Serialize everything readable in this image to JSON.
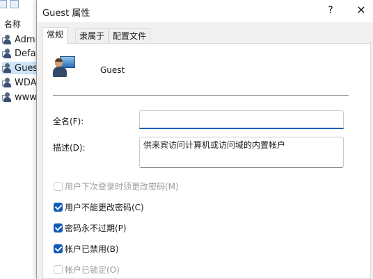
{
  "background_window": {
    "column_header": "名称",
    "rows": [
      {
        "label": "Admi",
        "selected": false
      },
      {
        "label": "Defau",
        "selected": false
      },
      {
        "label": "Guest",
        "selected": true
      },
      {
        "label": "WDA",
        "selected": false
      },
      {
        "label": "www.",
        "selected": false
      }
    ]
  },
  "dialog": {
    "title": "Guest 属性",
    "help_label": "?",
    "close_label": "✕",
    "tabs": [
      {
        "label": "常规",
        "active": true
      },
      {
        "label": "隶属于",
        "active": false
      },
      {
        "label": "配置文件",
        "active": false
      }
    ],
    "user_name": "Guest",
    "fullname_label": "全名(F):",
    "fullname_value": "",
    "description_label": "描述(D):",
    "description_value": "供来宾访问计算机或访问域的内置帐户",
    "checkboxes": [
      {
        "label": "用户下次登录时须更改密码(M)",
        "checked": false,
        "enabled": false
      },
      {
        "label": "用户不能更改密码(C)",
        "checked": true,
        "enabled": true
      },
      {
        "label": "密码永不过期(P)",
        "checked": true,
        "enabled": true
      },
      {
        "label": "帐户已禁用(B)",
        "checked": true,
        "enabled": true
      },
      {
        "label": "帐户已锁定(O)",
        "checked": false,
        "enabled": false
      }
    ]
  },
  "colors": {
    "accent": "#0f5ab8",
    "selection": "#cce4f7"
  }
}
